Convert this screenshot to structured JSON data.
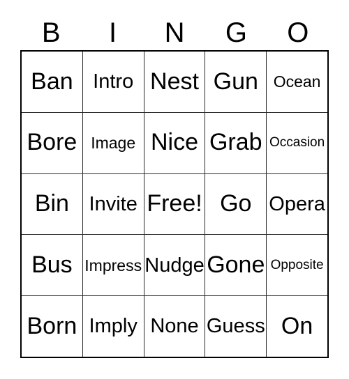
{
  "card": {
    "title": "BINGO",
    "header_letters": [
      "B",
      "I",
      "N",
      "G",
      "O"
    ],
    "free_space_label": "Free!",
    "free_space_position": {
      "row": 3,
      "column": 3
    },
    "grid_size": "5x5",
    "colors": {
      "background": "#ffffff",
      "text": "#000000",
      "outer_border": "#000000",
      "inner_border": "#2b2b2b"
    },
    "columns": {
      "B": [
        "Ban",
        "Bore",
        "Bin",
        "Bus",
        "Born"
      ],
      "I": [
        "Intro",
        "Image",
        "Invite",
        "Impress",
        "Imply"
      ],
      "N": [
        "Nest",
        "Nice",
        "Free!",
        "Nudge",
        "None"
      ],
      "G": [
        "Gun",
        "Grab",
        "Go",
        "Gone",
        "Guess"
      ],
      "O": [
        "Ocean",
        "Occasion",
        "Opera",
        "Opposite",
        "On"
      ]
    },
    "rows": [
      {
        "cells": [
          {
            "text": "Ban",
            "size": "len-s"
          },
          {
            "text": "Intro",
            "size": "len-m"
          },
          {
            "text": "Nest",
            "size": "len-s"
          },
          {
            "text": "Gun",
            "size": "len-s"
          },
          {
            "text": "Ocean",
            "size": "len-l"
          }
        ]
      },
      {
        "cells": [
          {
            "text": "Bore",
            "size": "len-s"
          },
          {
            "text": "Image",
            "size": "len-l"
          },
          {
            "text": "Nice",
            "size": "len-s"
          },
          {
            "text": "Grab",
            "size": "len-s"
          },
          {
            "text": "Occasion",
            "size": "len-xl"
          }
        ]
      },
      {
        "cells": [
          {
            "text": "Bin",
            "size": "len-s"
          },
          {
            "text": "Invite",
            "size": "len-m"
          },
          {
            "text": "Free!",
            "size": "len-s"
          },
          {
            "text": "Go",
            "size": "len-s"
          },
          {
            "text": "Opera",
            "size": "len-m"
          }
        ]
      },
      {
        "cells": [
          {
            "text": "Bus",
            "size": "len-s"
          },
          {
            "text": "Impress",
            "size": "len-l"
          },
          {
            "text": "Nudge",
            "size": "len-m"
          },
          {
            "text": "Gone",
            "size": "len-s"
          },
          {
            "text": "Opposite",
            "size": "len-xl"
          }
        ]
      },
      {
        "cells": [
          {
            "text": "Born",
            "size": "len-s"
          },
          {
            "text": "Imply",
            "size": "len-m"
          },
          {
            "text": "None",
            "size": "len-m"
          },
          {
            "text": "Guess",
            "size": "len-m"
          },
          {
            "text": "On",
            "size": "len-s"
          }
        ]
      }
    ]
  }
}
